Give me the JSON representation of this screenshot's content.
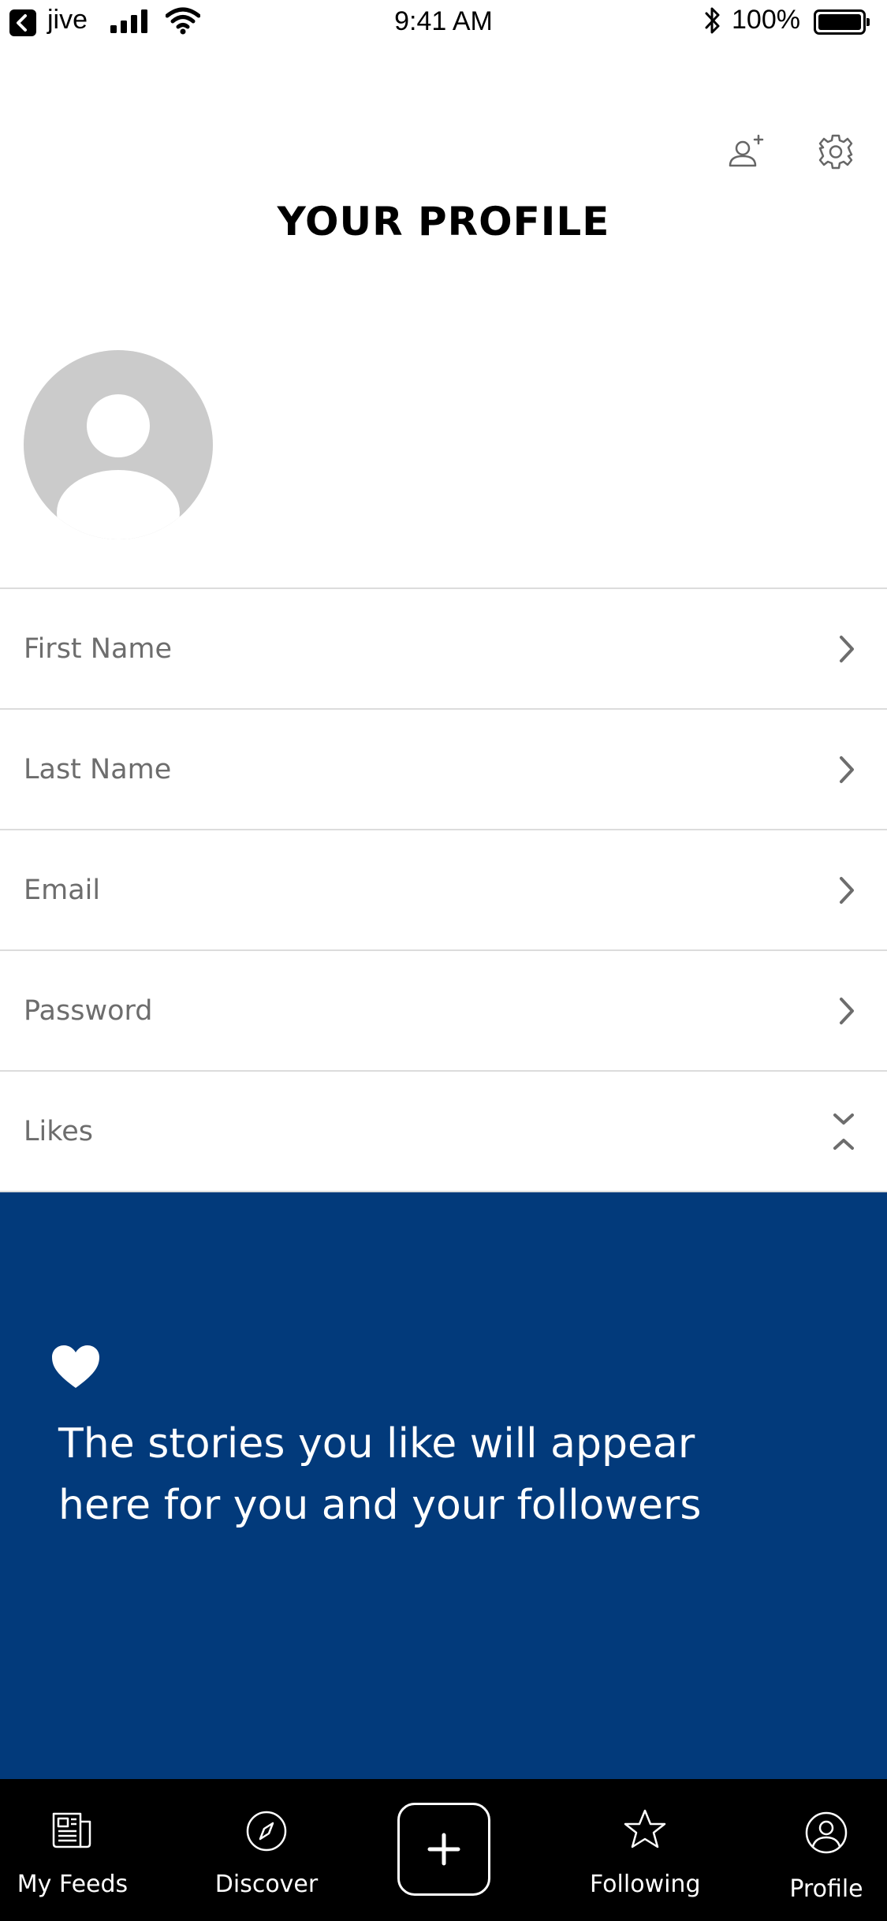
{
  "status_bar": {
    "back_app": "jive",
    "time": "9:41 AM",
    "battery": "100%"
  },
  "header": {
    "title": "YOUR PROFILE",
    "add_user_icon": "add-user-icon",
    "settings_icon": "gear-icon"
  },
  "profile": {
    "avatar_icon": "default-avatar-icon",
    "fields": [
      {
        "label": "First Name",
        "icon": "chevron-right-icon"
      },
      {
        "label": "Last Name",
        "icon": "chevron-right-icon"
      },
      {
        "label": "Email",
        "icon": "chevron-right-icon"
      },
      {
        "label": "Password",
        "icon": "chevron-right-icon"
      },
      {
        "label": "Likes",
        "icon": "collapse-chevron-icon"
      }
    ]
  },
  "likes_panel": {
    "icon": "heart-icon",
    "line1": "The stories you like will appear",
    "line2": "here for you and your followers",
    "background": "#023a7b"
  },
  "tab_bar": {
    "tabs": [
      {
        "label": "My Feeds",
        "icon": "newspaper-icon"
      },
      {
        "label": "Discover",
        "icon": "compass-icon"
      },
      {
        "label": "",
        "icon": "plus-icon"
      },
      {
        "label": "Following",
        "icon": "star-icon"
      },
      {
        "label": "Profile",
        "icon": "person-icon"
      }
    ],
    "background": "#000000"
  }
}
